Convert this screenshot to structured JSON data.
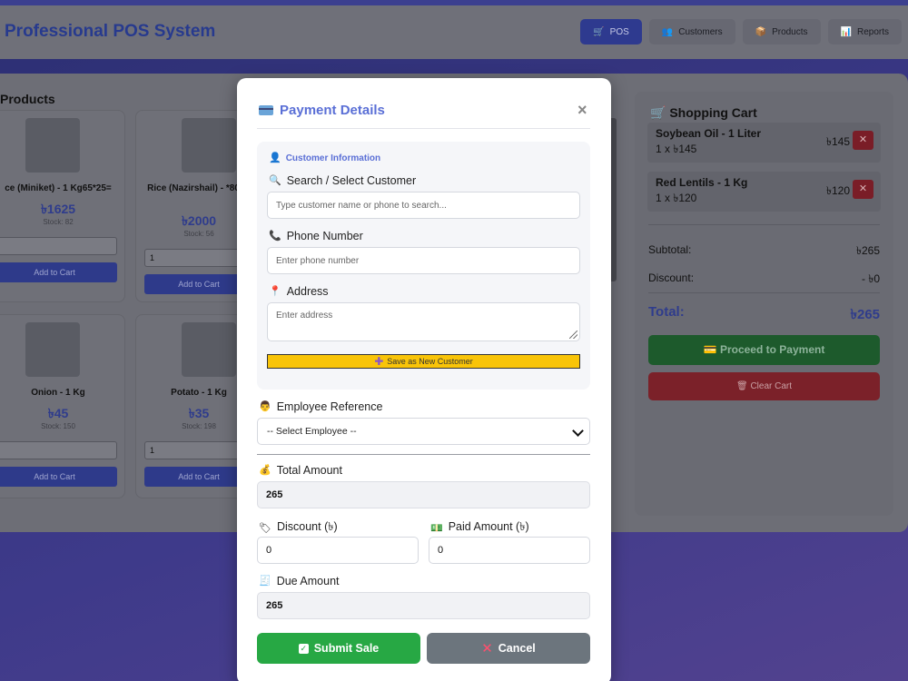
{
  "app": {
    "title": "Professional POS System",
    "nav": [
      {
        "label": "POS",
        "icon": "cart-icon",
        "active": true
      },
      {
        "label": "Customers",
        "icon": "users-icon",
        "active": false
      },
      {
        "label": "Products",
        "icon": "box-icon",
        "active": false
      },
      {
        "label": "Reports",
        "icon": "chart-icon",
        "active": false
      }
    ]
  },
  "products": {
    "title": "Products",
    "items": [
      {
        "name": "ce (Miniket) - 1 Kg65*25=",
        "price": "৳1625",
        "stock": "Stock: 82",
        "qty": "",
        "add_label": "Add to Cart"
      },
      {
        "name": "Rice (Nazirshail) - *80",
        "price": "৳2000",
        "stock": "Stock: 56",
        "qty": "1",
        "add_label": "Add to Cart"
      },
      {
        "name": "Onion - 1 Kg",
        "price": "৳45",
        "stock": "Stock: 150",
        "qty": "",
        "add_label": "Add to Cart"
      },
      {
        "name": "Potato - 1 Kg",
        "price": "৳35",
        "stock": "Stock: 198",
        "qty": "1",
        "add_label": "Add to Cart"
      }
    ]
  },
  "cart": {
    "title": "Shopping Cart",
    "items": [
      {
        "name": "Soybean Oil - 1 Liter",
        "qty_line": "1 x ৳145",
        "total": "৳145"
      },
      {
        "name": "Red Lentils - 1 Kg",
        "qty_line": "1 x ৳120",
        "total": "৳120"
      }
    ],
    "subtotal_label": "Subtotal:",
    "subtotal": "৳265",
    "discount_label": "Discount:",
    "discount": "- ৳0",
    "total_label": "Total:",
    "total": "৳265",
    "pay_label": "Proceed to Payment",
    "clear_label": "Clear Cart"
  },
  "modal": {
    "title": "Payment Details",
    "close": "×",
    "customer_section": "Customer Information",
    "search_label": "Search / Select Customer",
    "search_placeholder": "Type customer name or phone to search...",
    "phone_label": "Phone Number",
    "phone_placeholder": "Enter phone number",
    "address_label": "Address",
    "address_placeholder": "Enter address",
    "save_new_label": "Save as New Customer",
    "employee_label": "Employee Reference",
    "employee_selected": "-- Select Employee --",
    "total_label": "Total Amount",
    "total_value": "265",
    "discount_label": "Discount (৳)",
    "discount_value": "0",
    "paid_label": "Paid Amount (৳)",
    "paid_value": "0",
    "due_label": "Due Amount",
    "due_value": "265",
    "submit_label": "Submit Sale",
    "cancel_label": "Cancel"
  }
}
